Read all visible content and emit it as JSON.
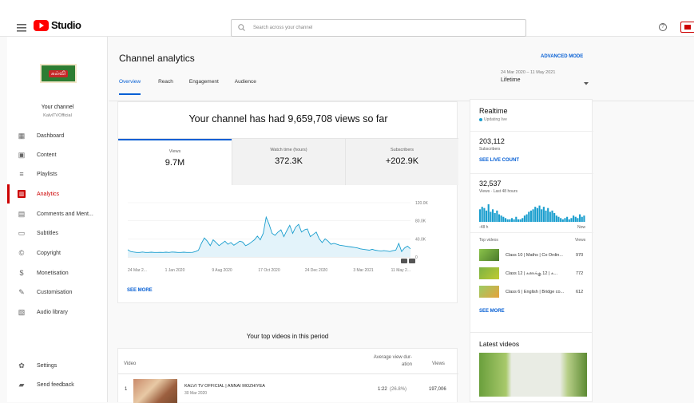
{
  "app": {
    "name": "Studio"
  },
  "search": {
    "placeholder": "Search across your channel"
  },
  "channel": {
    "title": "Your channel",
    "handle": "KalviTVOfficial",
    "logo_text": "கல்வி"
  },
  "sidebar": {
    "items": [
      {
        "label": "Dashboard",
        "icon": "dashboard-icon"
      },
      {
        "label": "Content",
        "icon": "content-icon"
      },
      {
        "label": "Playlists",
        "icon": "playlists-icon"
      },
      {
        "label": "Analytics",
        "icon": "analytics-icon",
        "active": true
      },
      {
        "label": "Comments and Ment...",
        "icon": "comments-icon"
      },
      {
        "label": "Subtitles",
        "icon": "subtitles-icon"
      },
      {
        "label": "Copyright",
        "icon": "copyright-icon"
      },
      {
        "label": "Monetisation",
        "icon": "monetisation-icon"
      },
      {
        "label": "Customisation",
        "icon": "customisation-icon"
      },
      {
        "label": "Audio library",
        "icon": "audio-library-icon"
      }
    ],
    "bottom": [
      {
        "label": "Settings",
        "icon": "settings-icon"
      },
      {
        "label": "Send feedback",
        "icon": "feedback-icon"
      }
    ]
  },
  "analytics": {
    "title": "Channel analytics",
    "advanced_mode": "ADVANCED MODE",
    "tabs": [
      "Overview",
      "Reach",
      "Engagement",
      "Audience"
    ],
    "date_range": "24 Mar 2020 – 11 May 2021",
    "period": "Lifetime",
    "headline": "Your channel has had 9,659,708 views so far",
    "metrics": [
      {
        "label": "Views",
        "value": "9.7M"
      },
      {
        "label": "Watch time (hours)",
        "value": "372.3K"
      },
      {
        "label": "Subscribers",
        "value": "+202.9K"
      }
    ],
    "see_more": "SEE MORE",
    "top_videos_title": "Your top videos in this period",
    "table_headers": {
      "video": "Video",
      "avg_view": "Average view dur-ation",
      "views": "Views"
    },
    "top_videos": [
      {
        "rank": "1",
        "title": "KALVI TV OFFICIAL | ANNAI MOZHIYEA",
        "date": "30 Mar 2020",
        "avg": "1:22",
        "pct": "(26.8%)",
        "views": "197,006"
      }
    ]
  },
  "chart_data": {
    "type": "line",
    "x_ticks": [
      "24 Mar 2...",
      "1 Jan 2020",
      "9 Aug 2020",
      "17 Oct 2020",
      "24 Dec 2020",
      "3 Mar 2021",
      "11 May 2..."
    ],
    "y_ticks": [
      "120.0K",
      "80.0K",
      "40.0K",
      "0"
    ],
    "ylim": [
      0,
      120000
    ],
    "series": [
      {
        "values": [
          16000,
          12000,
          11000,
          10000,
          10000,
          11000,
          10000,
          10000,
          10500,
          10000,
          10000,
          10200,
          10000,
          10500,
          10000,
          11000,
          10500,
          10000,
          10000,
          10500,
          10000,
          10000,
          10200,
          12000,
          15000,
          30000,
          42000,
          35000,
          25000,
          38000,
          32000,
          25000,
          30000,
          35000,
          28000,
          32000,
          26000,
          30000,
          35000,
          33000,
          25000,
          28000,
          33000,
          38000,
          46000,
          38000,
          52000,
          88000,
          72000,
          52000,
          48000,
          55000,
          60000,
          45000,
          58000,
          70000,
          52000,
          66000,
          72000,
          55000,
          60000,
          62000,
          45000,
          50000,
          55000,
          40000,
          32000,
          40000,
          35000,
          28000,
          30000,
          28000,
          26000,
          25000,
          24000,
          23000,
          22000,
          21000,
          20000,
          18000,
          17000,
          16000,
          15000,
          17000,
          15000,
          14000,
          13000,
          14000,
          13000,
          12000,
          14000,
          15000,
          30000,
          12000,
          20000,
          24000,
          18000
        ]
      }
    ],
    "accent": "#1a9ece"
  },
  "realtime": {
    "title": "Realtime",
    "status": "Updating live",
    "subs_value": "203,112",
    "subs_label": "Subscribers",
    "see_live": "SEE LIVE COUNT",
    "views_value": "32,537",
    "views_label": "Views · Last 48 hours",
    "axis_left": "-48 h",
    "axis_right": "Now",
    "bars": [
      10,
      12,
      11,
      9,
      14,
      8,
      10,
      7,
      9,
      6,
      5,
      4,
      3,
      2,
      2,
      3,
      2,
      4,
      2,
      2,
      3,
      5,
      6,
      8,
      9,
      10,
      12,
      11,
      13,
      10,
      12,
      9,
      11,
      8,
      9,
      7,
      5,
      4,
      3,
      2,
      3,
      4,
      2,
      3,
      5,
      4,
      3,
      6,
      4,
      5
    ],
    "top_videos_label": "Top videos",
    "views_col": "Views",
    "top_videos": [
      {
        "title": "Class 10 | Maths | Co Ordin...",
        "views": "970"
      },
      {
        "title": "Class 12 | கணக்கு 12 | க...",
        "views": "772"
      },
      {
        "title": "Class 6 | English | Bridge co...",
        "views": "612"
      }
    ],
    "see_more": "SEE MORE"
  },
  "latest": {
    "title": "Latest videos"
  }
}
